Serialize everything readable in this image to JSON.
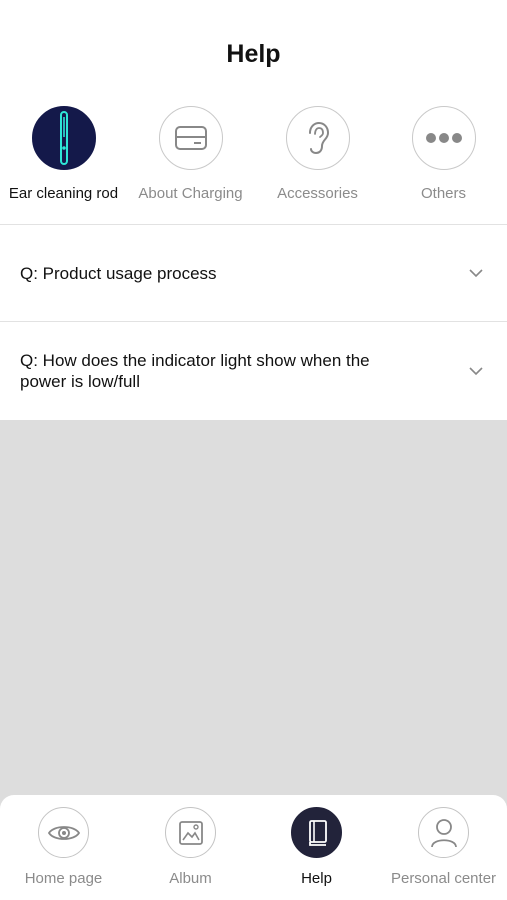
{
  "header": {
    "title": "Help"
  },
  "categories": [
    {
      "label": "Ear cleaning rod",
      "icon": "ear-cleaning-rod-icon",
      "active": true
    },
    {
      "label": "About Charging",
      "icon": "charging-card-icon",
      "active": false
    },
    {
      "label": "Accessories",
      "icon": "ear-icon",
      "active": false
    },
    {
      "label": "Others",
      "icon": "more-dots-icon",
      "active": false
    }
  ],
  "faq": [
    {
      "question": "Q: Product usage process"
    },
    {
      "question": "Q: How does the indicator light show when the power is low/full"
    }
  ],
  "tabbar": [
    {
      "label": "Home page",
      "icon": "eye-icon",
      "active": false
    },
    {
      "label": "Album",
      "icon": "album-icon",
      "active": false
    },
    {
      "label": "Help",
      "icon": "book-icon",
      "active": true
    },
    {
      "label": "Personal center",
      "icon": "person-icon",
      "active": false
    }
  ],
  "colors": {
    "accent_dark": "#14194a",
    "rod_glow": "#2ee6d6",
    "inactive_text": "#8b8b8b",
    "empty_area": "#dddddd"
  }
}
